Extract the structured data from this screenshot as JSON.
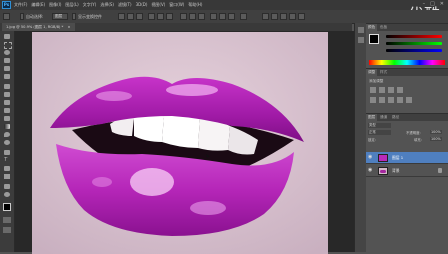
{
  "app": {
    "logo": "Ps",
    "watermark": "优酷"
  },
  "menu": [
    "文件(F)",
    "编辑(E)",
    "图像(I)",
    "图层(L)",
    "文字(Y)",
    "选择(S)",
    "滤镜(T)",
    "3D(D)",
    "视图(V)",
    "窗口(W)",
    "帮助(H)"
  ],
  "window_controls": {
    "minimize": "–",
    "maximize": "□",
    "close": "✕"
  },
  "options": {
    "auto_select": "自动选择:",
    "layer_select": "图层",
    "show_transform": "显示变换控件"
  },
  "document": {
    "tab_label": "1.jpg @ 50.9% (图层 1, RGB/8) *",
    "close": "×"
  },
  "panels": {
    "color": {
      "tab": "颜色",
      "tab2": "色板"
    },
    "adjustments": {
      "tab": "调整",
      "tab2": "样式",
      "add": "添加调整"
    },
    "layers": {
      "tab": "图层",
      "tab2": "通道",
      "tab3": "路径",
      "kind": "类型",
      "blend_mode": "正常",
      "opacity_label": "不透明度:",
      "opacity": "100%",
      "lock_label": "锁定:",
      "fill_label": "填充:",
      "fill": "100%",
      "items": [
        {
          "name": "图层 1",
          "selected": true
        },
        {
          "name": "背景",
          "selected": false
        }
      ]
    }
  },
  "colors": {
    "accent": "#4f7fbf",
    "lip": "#b01fb6",
    "bg": "#535353"
  },
  "icons": [
    "move-icon",
    "marquee-icon",
    "lasso-icon",
    "quick-select-icon",
    "crop-icon",
    "eyedropper-icon",
    "healing-icon",
    "brush-icon",
    "clone-stamp-icon",
    "history-brush-icon",
    "eraser-icon",
    "gradient-icon",
    "blur-icon",
    "dodge-icon",
    "pen-icon",
    "type-icon",
    "path-select-icon",
    "shape-icon",
    "hand-icon",
    "zoom-icon"
  ]
}
